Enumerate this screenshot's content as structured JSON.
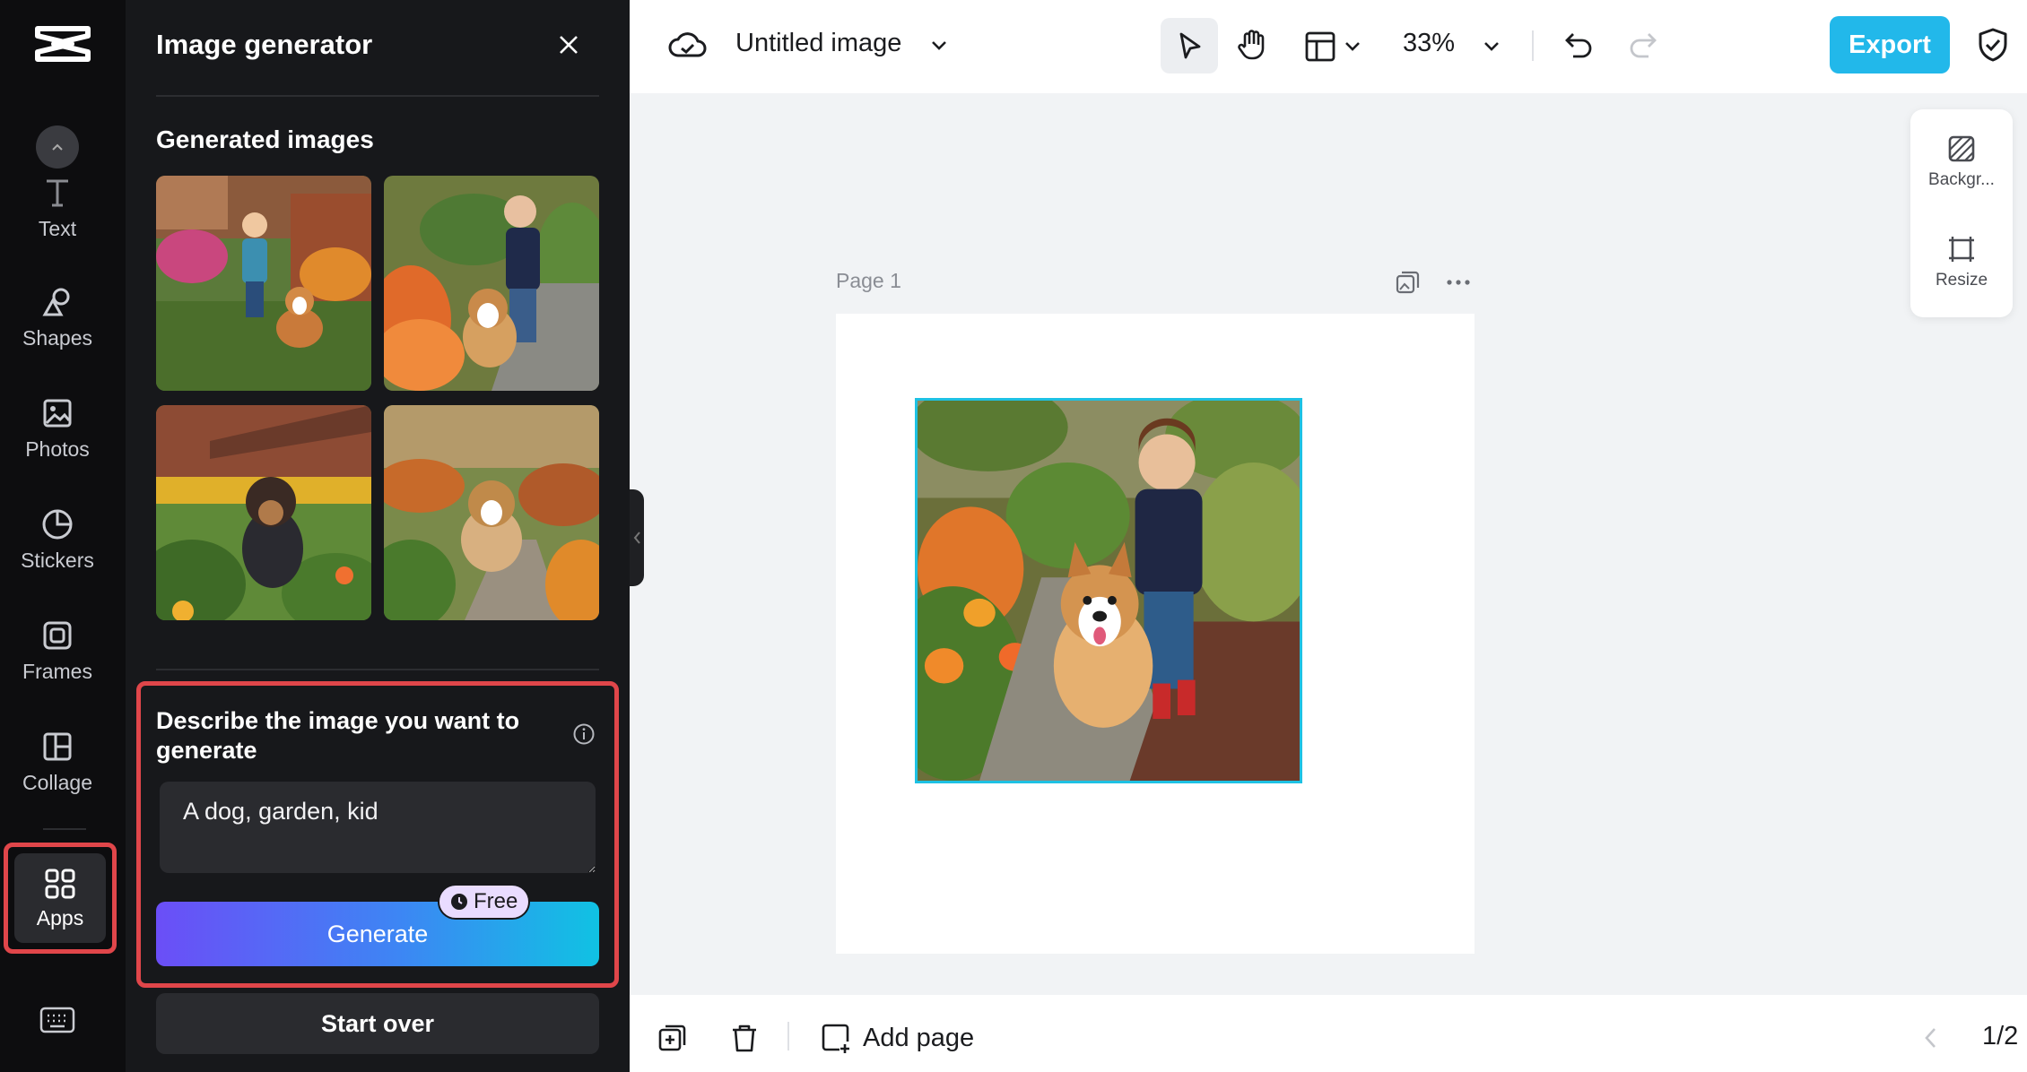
{
  "rail": {
    "items": [
      {
        "label": "Text"
      },
      {
        "label": "Shapes"
      },
      {
        "label": "Photos"
      },
      {
        "label": "Stickers"
      },
      {
        "label": "Frames"
      },
      {
        "label": "Collage"
      },
      {
        "label": "Apps"
      }
    ]
  },
  "panel": {
    "title": "Image generator",
    "generated_label": "Generated images",
    "describe_label": "Describe the image you want to generate",
    "prompt_value": "A dog, garden, kid",
    "generate_label": "Generate",
    "free_badge": "Free",
    "start_over_label": "Start over"
  },
  "topbar": {
    "document_title": "Untitled image",
    "zoom": "33%",
    "export_label": "Export"
  },
  "canvas": {
    "page_label": "Page 1"
  },
  "sidecard": {
    "background_label": "Backgr...",
    "resize_label": "Resize"
  },
  "bottombar": {
    "add_page_label": "Add page",
    "page_indicator": "1/2"
  },
  "colors": {
    "accent": "#22b8ea",
    "highlight": "#e0464a",
    "panel_bg": "#17181b",
    "rail_bg": "#0d0d0f"
  }
}
